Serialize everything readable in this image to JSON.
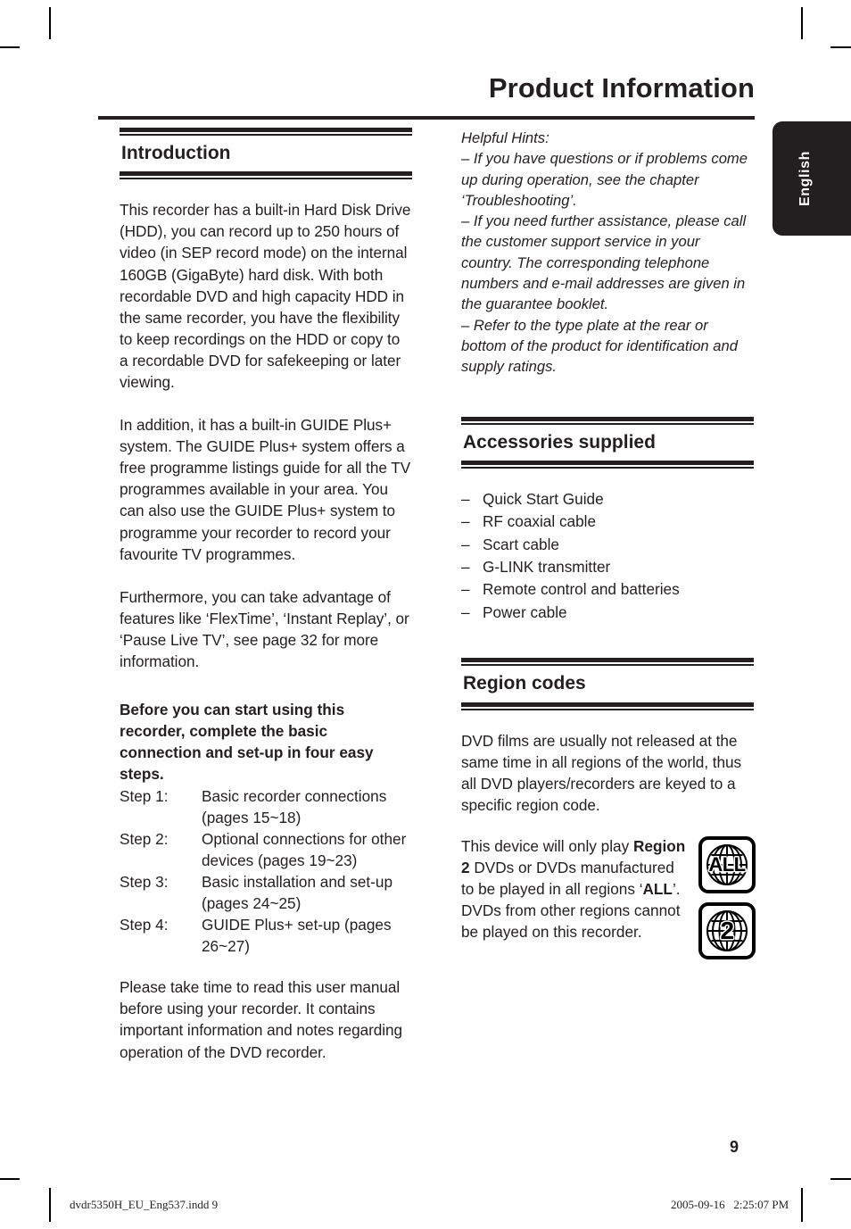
{
  "page": {
    "title": "Product Information",
    "language_tab": "English",
    "page_number": "9"
  },
  "left_column": {
    "introduction": {
      "heading": "Introduction",
      "paragraph1": "This recorder has a built-in Hard Disk Drive (HDD), you can record up to 250 hours of video (in SEP record mode) on the internal 160GB (GigaByte) hard disk. With both recordable DVD and high capacity HDD in the same recorder, you have the flexibility to keep recordings on the HDD or copy to a recordable DVD for safekeeping or later viewing.",
      "paragraph2": "In addition, it has a built-in GUIDE Plus+ system. The GUIDE Plus+ system offers a free programme listings guide for all the TV programmes available in your area. You can also use the GUIDE Plus+ system to programme your recorder to record your favourite TV programmes.",
      "paragraph3": "Furthermore, you can take advantage of features like ‘FlexTime’, ‘Instant Replay’, or ‘Pause Live TV’, see page 32 for more information.",
      "bold_lead": "Before you can start using this recorder, complete the basic connection and set-up in four easy steps.",
      "steps": [
        {
          "label": "Step 1:",
          "description": "Basic recorder connections (pages 15~18)"
        },
        {
          "label": "Step 2:",
          "description": "Optional connections for other devices (pages 19~23)"
        },
        {
          "label": "Step 3:",
          "description": "Basic installation and set-up (pages 24~25)"
        },
        {
          "label": "Step 4:",
          "description": "GUIDE Plus+ set-up (pages 26~27)"
        }
      ],
      "paragraph4": "Please take time to read this user manual before using your recorder. It contains important information and notes regarding operation of the DVD recorder."
    }
  },
  "right_column": {
    "helpful_hints": {
      "title": "Helpful Hints:",
      "items": [
        "–  If you have questions or if problems come up during operation, see the chapter ‘Troubleshooting’.",
        "–  If you need further assistance, please call the customer support service in your country. The corresponding telephone numbers and e-mail addresses are given in the guarantee booklet.",
        "–  Refer to the type plate at the rear or bottom of the product for identification and supply ratings."
      ]
    },
    "accessories": {
      "heading": "Accessories supplied",
      "dash": "–",
      "items": [
        "Quick Start Guide",
        "RF coaxial cable",
        "Scart cable",
        "G-LINK transmitter",
        "Remote control and batteries",
        "Power cable"
      ]
    },
    "region_codes": {
      "heading": "Region codes",
      "paragraph1": "DVD films are usually not released at the same time in all regions of the world, thus all DVD players/recorders are keyed to a specific region code.",
      "paragraph2_part1": "This device will only play ",
      "paragraph2_bold1": "Region 2",
      "paragraph2_part2": " DVDs or DVDs manufactured to be played in all regions ‘",
      "paragraph2_bold2": "ALL",
      "paragraph2_part3": "’.  DVDs from other regions cannot be played on this recorder.",
      "badges": [
        {
          "label": "ALL",
          "icon": "globe-icon"
        },
        {
          "label": "2",
          "icon": "globe-icon"
        }
      ]
    }
  },
  "footer": {
    "file_name": "dvdr5350H_EU_Eng537.indd   9",
    "timestamp": "2005-09-16   2:25:07 PM"
  }
}
